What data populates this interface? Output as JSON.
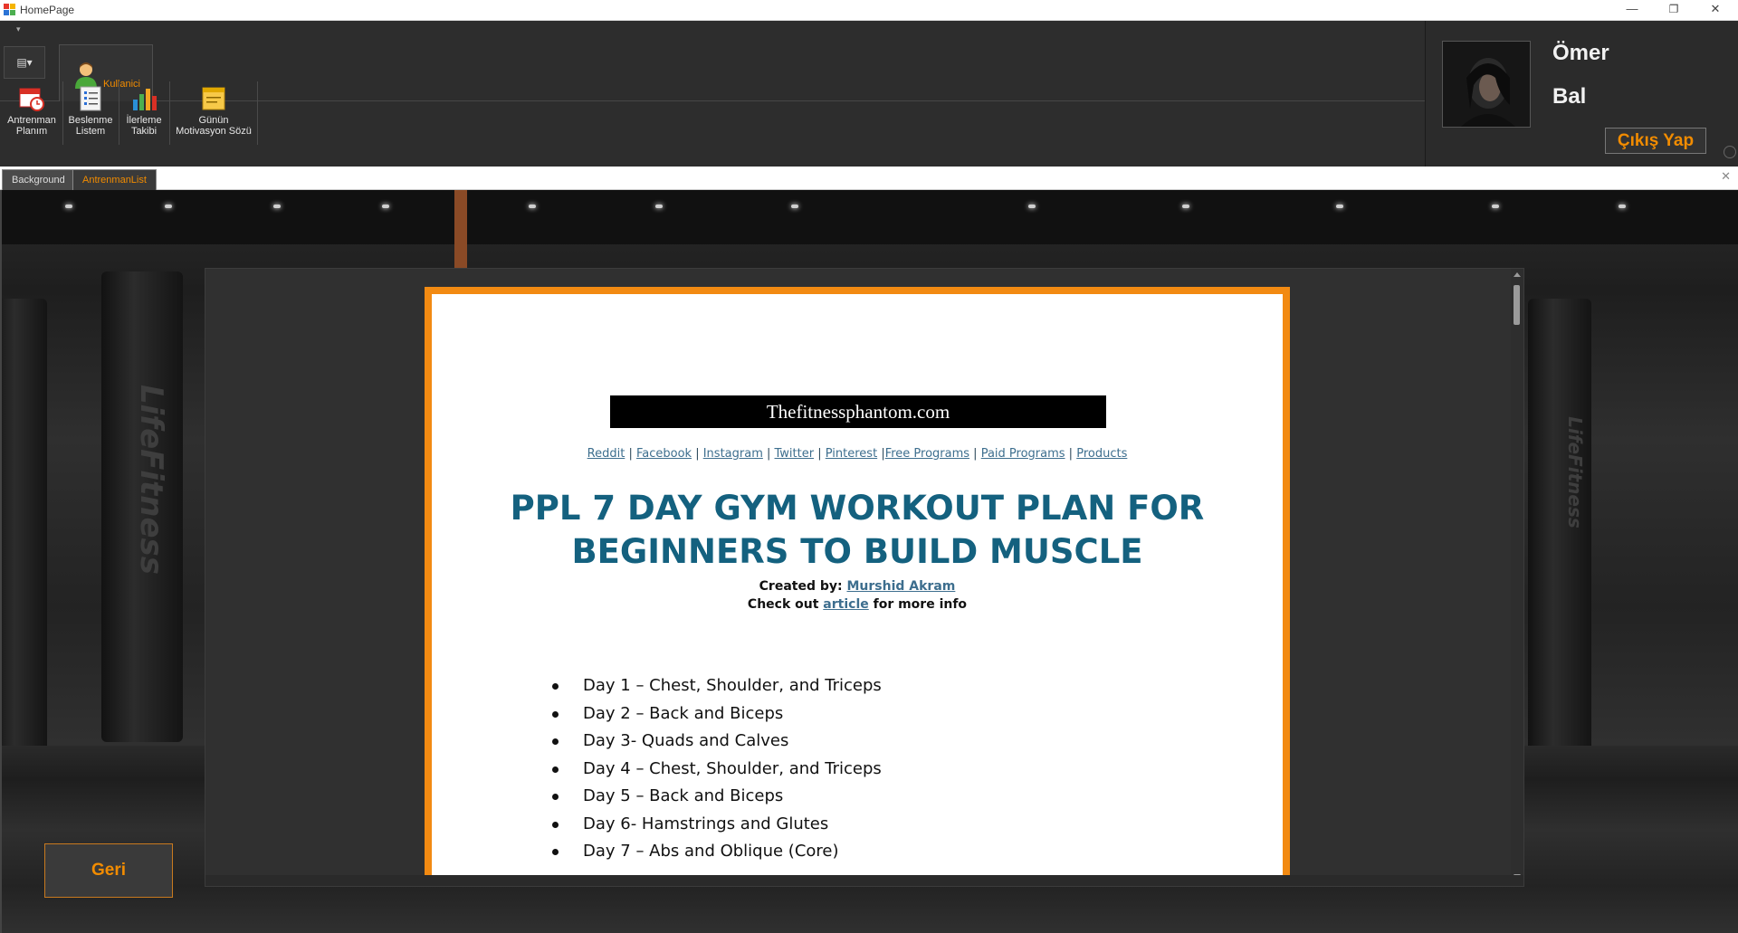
{
  "window": {
    "title": "HomePage",
    "minimize": "—",
    "restore": "❐",
    "close": "✕"
  },
  "ribbon": {
    "quick_access": "▾",
    "app_menu": "▤▾",
    "tab_label": "Kullanici",
    "buttons": [
      {
        "line1": "Antrenman",
        "line2": "Planım",
        "icon": "calendar-clock-icon"
      },
      {
        "line1": "Beslenme",
        "line2": "Listem",
        "icon": "checklist-icon"
      },
      {
        "line1": "İlerleme",
        "line2": "Takibi",
        "icon": "bar-chart-icon"
      },
      {
        "line1": "Günün",
        "line2": "Motivasyon Sözü",
        "icon": "note-icon"
      }
    ]
  },
  "user": {
    "first_name": "Ömer",
    "last_name": "Bal",
    "logout_label": "Çıkış Yap"
  },
  "doc_tabs": [
    {
      "label": "Background",
      "active": false
    },
    {
      "label": "AntrenmanList",
      "active": true
    }
  ],
  "doc_close": "✕",
  "document": {
    "site": "Thefitnessphantom.com",
    "links": [
      "Reddit",
      "Facebook",
      "Instagram",
      "Twitter",
      "Pinterest",
      "Free Programs",
      "Paid Programs",
      "Products"
    ],
    "title_line1": "PPL 7 DAY GYM WORKOUT PLAN FOR",
    "title_line2": "BEGINNERS TO BUILD MUSCLE",
    "created_by_label": "Created by:",
    "author": "Murshid Akram",
    "check_out_prefix": "Check out",
    "article_link": "article",
    "check_out_suffix": "for more info",
    "days": [
      "Day 1 – Chest, Shoulder, and Triceps",
      "Day 2 – Back and Biceps",
      "Day 3- Quads and Calves",
      "Day 4 – Chest, Shoulder, and Triceps",
      "Day 5 – Back and Biceps",
      "Day 6- Hamstrings and Glutes",
      "Day 7 – Abs and Oblique (Core)"
    ]
  },
  "back_button": "Geri",
  "colors": {
    "accent": "#f28c00",
    "title_blue": "#14617f",
    "page_border": "#f28a12"
  }
}
